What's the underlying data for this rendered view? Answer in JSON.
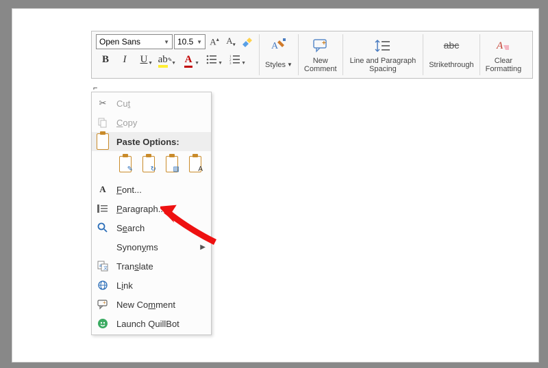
{
  "ribbon": {
    "font_name": "Open Sans",
    "font_size": "10.5",
    "styles": "Styles",
    "new_comment": "New\nComment",
    "spacing": "Line and Paragraph\nSpacing",
    "strike": "Strikethrough",
    "clear_fmt": "Clear\nFormatting"
  },
  "context_menu": {
    "cut": "Cut",
    "copy": "Copy",
    "paste_options": "Paste Options:",
    "font": "Font...",
    "paragraph": "Paragraph...",
    "search": "Search",
    "synonyms": "Synonyms",
    "translate": "Translate",
    "link": "Link",
    "new_comment": "New Comment",
    "quillbot": "Launch QuillBot"
  }
}
